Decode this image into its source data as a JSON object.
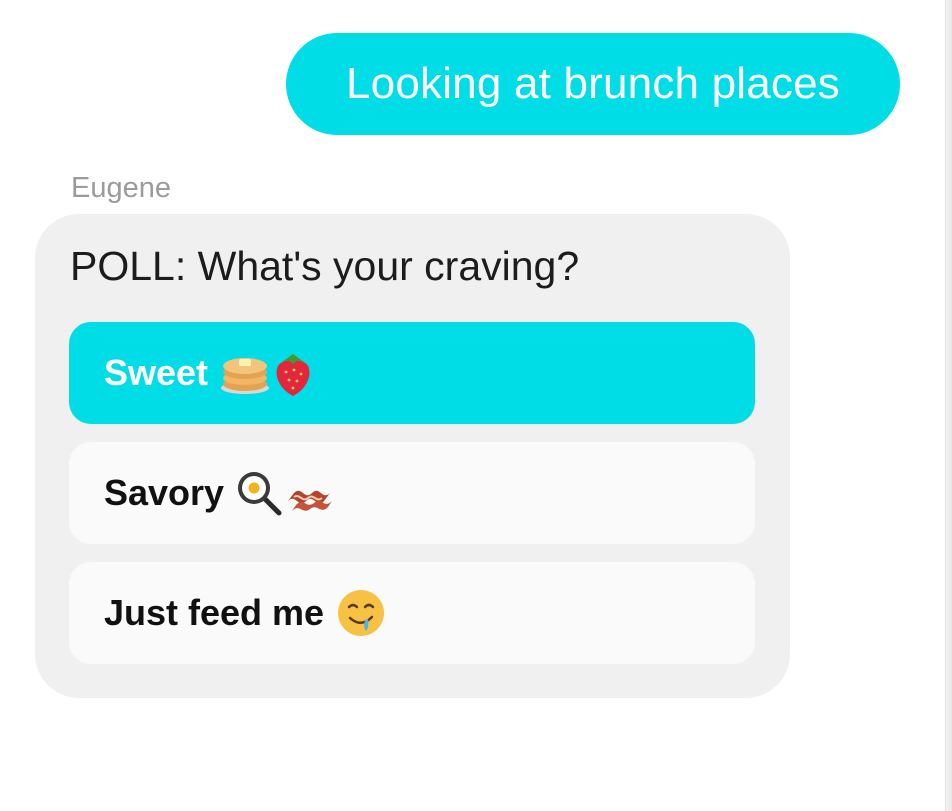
{
  "messages": {
    "outgoing_text": "Looking at brunch places",
    "sender_name": "Eugene"
  },
  "poll": {
    "question": "POLL: What's your craving?",
    "options": [
      {
        "label": "Sweet",
        "emoji_icons": [
          "pancakes-icon",
          "strawberry-icon"
        ],
        "selected": true
      },
      {
        "label": "Savory",
        "emoji_icons": [
          "frying-pan-egg-icon",
          "bacon-icon"
        ],
        "selected": false
      },
      {
        "label": "Just feed me",
        "emoji_icons": [
          "drooling-face-icon"
        ],
        "selected": false
      }
    ]
  },
  "colors": {
    "accent": "#00dde6",
    "card_background": "#f0f0f0",
    "option_background": "#fafafa",
    "sender_text": "#9b9b9b"
  }
}
